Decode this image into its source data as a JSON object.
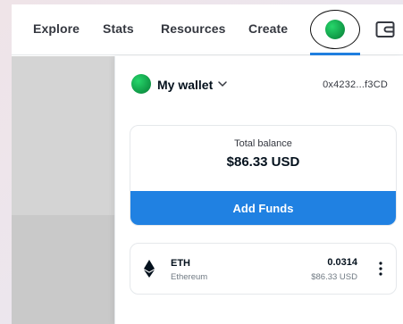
{
  "nav": {
    "items": [
      {
        "label": "Explore"
      },
      {
        "label": "Stats"
      },
      {
        "label": "Resources"
      },
      {
        "label": "Create"
      }
    ],
    "profile_icon": "avatar-icon",
    "wallet_icon": "wallet-icon"
  },
  "wallet": {
    "title": "My wallet",
    "address": "0x4232...f3CD",
    "chevron_icon": "chevron-down-icon"
  },
  "balance": {
    "label": "Total balance",
    "amount": "$86.33 USD",
    "add_funds_label": "Add Funds"
  },
  "tokens": [
    {
      "symbol": "ETH",
      "name": "Ethereum",
      "amount": "0.0314",
      "usd": "$86.33 USD",
      "icon": "ethereum-icon"
    }
  ],
  "colors": {
    "accent": "#2081e2",
    "avatar_green": "#12a04a",
    "text_primary": "#04111d",
    "text_secondary": "#707a83"
  }
}
